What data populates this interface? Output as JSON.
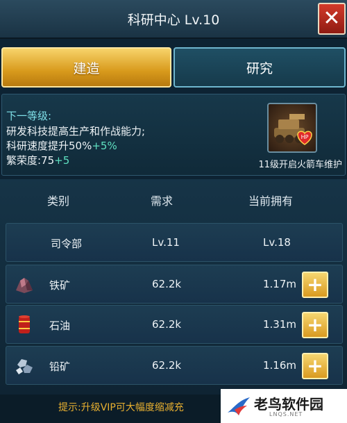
{
  "header": {
    "title": "科研中心 Lv.10"
  },
  "tabs": {
    "build": "建造",
    "research": "研究"
  },
  "info": {
    "next_level_label": "下一等级:",
    "line1": "研发科技提高生产和作战能力;",
    "line2_base": "科研速度提升50%",
    "line2_bonus": "+5%",
    "line3_base": "繁荣度:75",
    "line3_bonus": "+5",
    "unit_caption": "11级开启火箭车维护"
  },
  "table": {
    "headers": {
      "category": "类别",
      "requirement": "需求",
      "owned": "当前拥有"
    },
    "rows": [
      {
        "name": "司令部",
        "requirement": "Lv.11",
        "owned": "Lv.18",
        "icon": "none"
      },
      {
        "name": "铁矿",
        "requirement": "62.2k",
        "owned": "1.17m",
        "icon": "iron-ore-icon"
      },
      {
        "name": "石油",
        "requirement": "62.2k",
        "owned": "1.31m",
        "icon": "oil-barrel-icon"
      },
      {
        "name": "铅矿",
        "requirement": "62.2k",
        "owned": "1.16m",
        "icon": "lead-ore-icon"
      }
    ]
  },
  "footer": {
    "tip": "提示:升级VIP可大幅度缩减充"
  },
  "watermark": {
    "brand": "老鸟软件园",
    "domain": "LNQS.NET"
  },
  "colors": {
    "accent_gold": "#d89a1c",
    "highlight_green": "#5fe0c0",
    "tip_orange": "#e8b030"
  }
}
